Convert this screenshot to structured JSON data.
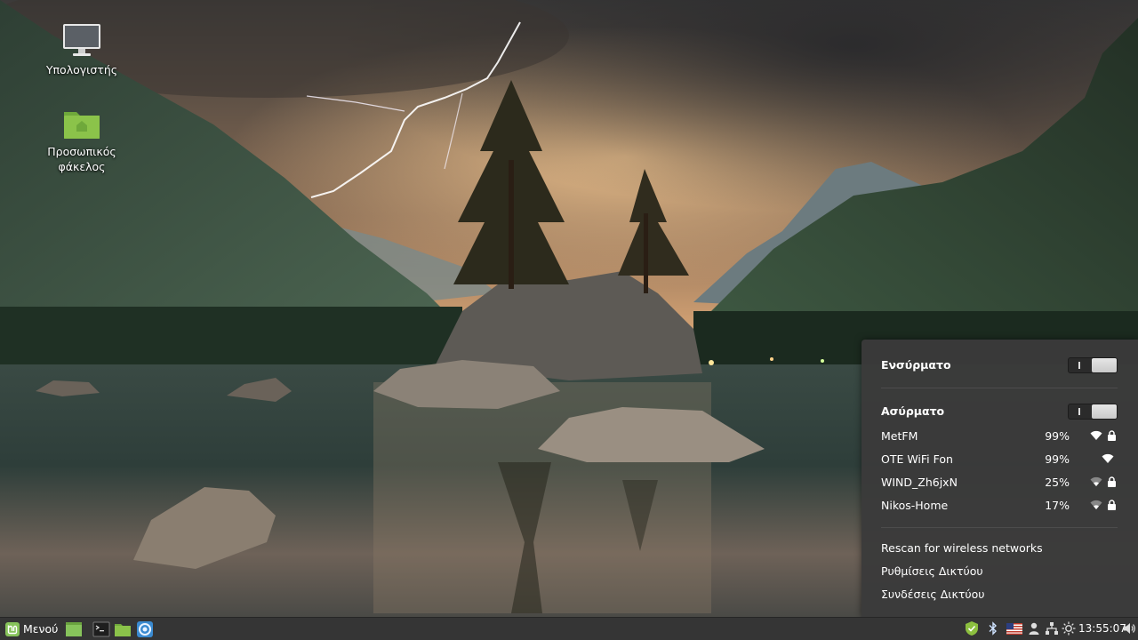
{
  "desktop": {
    "icons": [
      {
        "label": "Υπολογιστής",
        "icon": "computer-icon"
      },
      {
        "label": "Προσωπικός φάκελος",
        "icon": "home-folder-icon"
      }
    ]
  },
  "network_menu": {
    "wired": {
      "label": "Ενσύρματο",
      "enabled": false
    },
    "wireless": {
      "label": "Ασύρματο",
      "enabled": false,
      "networks": [
        {
          "ssid": "MetFM",
          "strength": "99%",
          "secured": true
        },
        {
          "ssid": "OTE WiFi Fon",
          "strength": "99%",
          "secured": false
        },
        {
          "ssid": "WIND_Zh6jxN",
          "strength": "25%",
          "secured": true
        },
        {
          "ssid": "Nikos-Home",
          "strength": "17%",
          "secured": true
        }
      ]
    },
    "actions": {
      "rescan": "Rescan for wireless networks",
      "settings": "Ρυθμίσεις Δικτύου",
      "connections": "Συνδέσεις Δικτύου"
    }
  },
  "taskbar": {
    "menu_label": "Μενού",
    "launchers": [
      "show-desktop-icon",
      "terminal-icon",
      "file-manager-icon",
      "browser-icon"
    ],
    "tray": [
      "shield-icon",
      "bluetooth-icon",
      "us-flag-icon",
      "user-icon",
      "network-icon",
      "brightness-icon",
      "volume-icon"
    ],
    "clock": "13:55:07"
  },
  "colors": {
    "panel_bg": "#353535",
    "popup_bg": "#3a3a3a",
    "mint_green": "#87c35b",
    "folder_green": "#8bc34a"
  }
}
